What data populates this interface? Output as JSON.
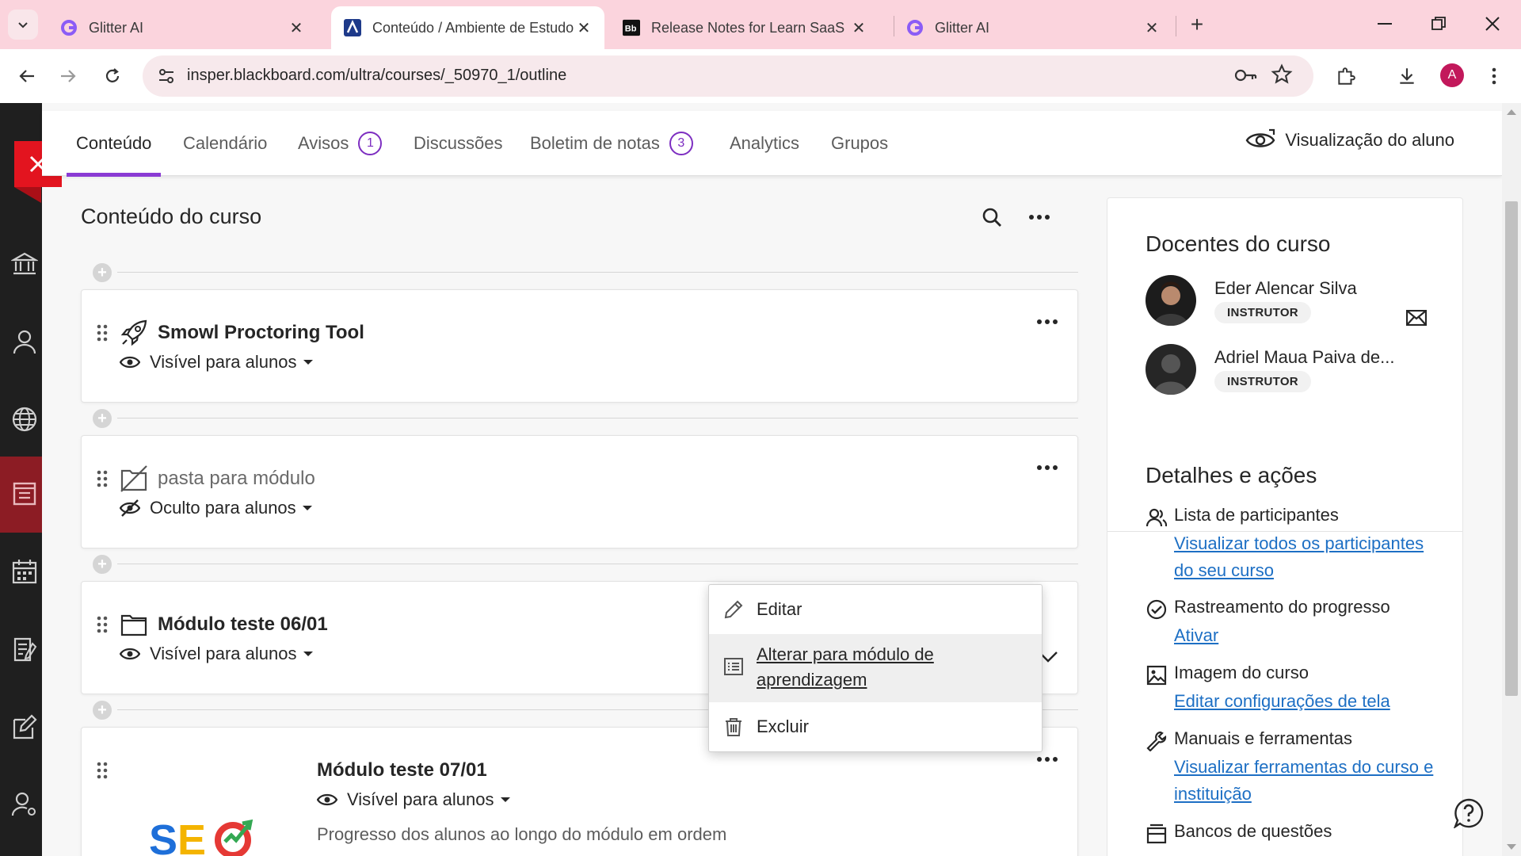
{
  "browser": {
    "tabs": [
      {
        "title": "Glitter AI",
        "favicon": "glitter-g-icon",
        "active": false
      },
      {
        "title": "Conteúdo / Ambiente de Estudo",
        "favicon": "insper-blackboard-icon",
        "active": true
      },
      {
        "title": "Release Notes for Learn SaaS | A",
        "favicon": "bb-icon",
        "active": false
      },
      {
        "title": "Glitter AI",
        "favicon": "glitter-g-icon",
        "active": false
      }
    ],
    "url": "insper.blackboard.com/ultra/courses/_50970_1/outline",
    "profile_initial": "A",
    "profile_color": "#c2185b",
    "tabbar_color": "#fbd4dd"
  },
  "course_nav": {
    "tabs": [
      {
        "label": "Conteúdo",
        "active": true,
        "badge": null
      },
      {
        "label": "Calendário",
        "active": false,
        "badge": null
      },
      {
        "label": "Avisos",
        "active": false,
        "badge": "1"
      },
      {
        "label": "Discussões",
        "active": false,
        "badge": null
      },
      {
        "label": "Boletim de notas",
        "active": false,
        "badge": "3"
      },
      {
        "label": "Analytics",
        "active": false,
        "badge": null
      },
      {
        "label": "Grupos",
        "active": false,
        "badge": null
      }
    ],
    "student_view_label": "Visualização do aluno",
    "accent_color": "#8a3bd4"
  },
  "content": {
    "title": "Conteúdo do curso",
    "items": [
      {
        "title": "Smowl Proctoring Tool",
        "icon": "rocket-icon",
        "visibility": "Visível para alunos",
        "visibility_icon": "eye-icon"
      },
      {
        "title": "pasta para módulo",
        "icon": "hidden-folder-icon",
        "visibility": "Oculto para alunos",
        "visibility_icon": "eye-slash-icon"
      },
      {
        "title": "Módulo teste 06/01",
        "icon": "folder-icon",
        "visibility": "Visível para alunos",
        "visibility_icon": "eye-icon"
      },
      {
        "title": "Módulo teste 07/01",
        "icon": "seo-image",
        "visibility": "Visível para alunos",
        "visibility_icon": "eye-icon",
        "description": "Progresso dos alunos ao longo do módulo em ordem",
        "image_text": "SEO"
      }
    ]
  },
  "context_menu": {
    "items": [
      {
        "label": "Editar",
        "icon": "pencil-icon"
      },
      {
        "label": "Alterar para módulo de aprendizagem",
        "icon": "module-list-icon",
        "hovered": true
      },
      {
        "label": "Excluir",
        "icon": "trash-icon"
      }
    ]
  },
  "right_panel": {
    "instructors_title": "Docentes do curso",
    "instructors": [
      {
        "name": "Eder Alencar Silva",
        "role": "INSTRUTOR"
      },
      {
        "name": "Adriel Maua Paiva de...",
        "role": "INSTRUTOR"
      }
    ],
    "details_title": "Detalhes e ações",
    "details": [
      {
        "title": "Lista de participantes",
        "link": "Visualizar todos os participantes do seu curso",
        "icon": "participants-icon"
      },
      {
        "title": "Rastreamento do progresso",
        "link": "Ativar",
        "icon": "check-circle-icon"
      },
      {
        "title": "Imagem do curso",
        "link": "Editar configurações de tela",
        "icon": "image-icon"
      },
      {
        "title": "Manuais e ferramentas",
        "link": "Visualizar ferramentas do curso e instituição",
        "icon": "wrench-icon"
      },
      {
        "title": "Bancos de questões",
        "link": "",
        "icon": "question-bank-icon"
      }
    ],
    "link_color": "#1d6fc4"
  }
}
